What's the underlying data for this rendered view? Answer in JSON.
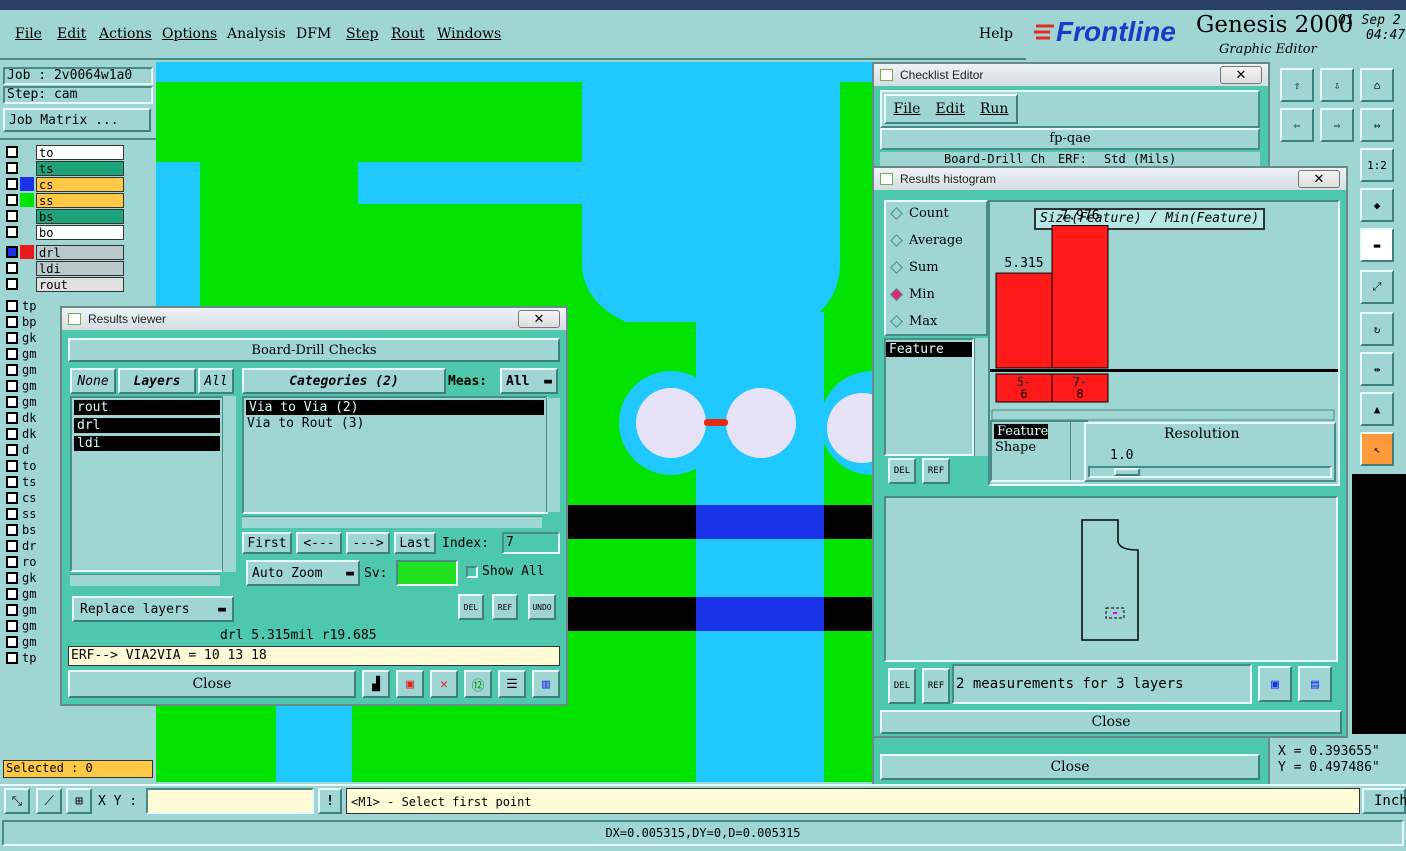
{
  "menu": {
    "file": "File",
    "edit": "Edit",
    "actions": "Actions",
    "options": "Options",
    "analysis": "Analysis",
    "dfm": "DFM",
    "step": "Step",
    "rout": "Rout",
    "windows": "Windows",
    "help": "Help"
  },
  "brand": {
    "logo": "Frontline",
    "product": "Genesis 2000",
    "subtitle": "Graphic Editor",
    "date": "01 Sep 2",
    "time": "04:47"
  },
  "left": {
    "job": "Job : 2v0064w1a0",
    "step": "Step: cam",
    "job_matrix": "Job Matrix ...",
    "layers_top": [
      {
        "name": "to",
        "color": "#ffffff"
      },
      {
        "name": "ts",
        "color": "#1fa37a"
      },
      {
        "name": "cs",
        "color": "#ffc845"
      },
      {
        "name": "ss",
        "color": "#ffc845"
      },
      {
        "name": "bs",
        "color": "#1fa37a"
      },
      {
        "name": "bo",
        "color": "#ffffff"
      }
    ],
    "layers_mid": [
      {
        "name": "drl",
        "color": "#b9c9cc"
      },
      {
        "name": "ldi",
        "color": "#b9c9cc"
      },
      {
        "name": "rout",
        "color": "#e0e0e0"
      }
    ],
    "layers_short": [
      "tp",
      "bp",
      "gk",
      "gm",
      "gm",
      "gm",
      "gm",
      "dk",
      "dk",
      "d",
      "to",
      "ts",
      "cs",
      "ss",
      "bs",
      "dr",
      "ro",
      "gk",
      "gm",
      "gm",
      "gm",
      "gm",
      "tp"
    ],
    "selected": "Selected : 0"
  },
  "results_viewer": {
    "title": "Results viewer",
    "header": "Board-Drill Checks",
    "none": "None",
    "layers": "Layers",
    "all": "All",
    "categories": "Categories (2)",
    "meas_label": "Meas:",
    "meas_value": "All",
    "layer_items": [
      "rout",
      "drl",
      "ldi"
    ],
    "category_items": [
      "Via to Via  (2)",
      "Via to Rout  (3)"
    ],
    "first": "First",
    "prev": "<---",
    "next": "--->",
    "last": "Last",
    "index_label": "Index:",
    "index_value": "7",
    "auto_zoom": "Auto Zoom",
    "sv_label": "Sv:",
    "show_all": "Show All",
    "replace_layers": "Replace layers",
    "del": "DEL",
    "ref": "REF",
    "undo": "UNDO",
    "info": "drl 5.315mil  r19.685",
    "erf": "ERF--> VIA2VIA = 10 13 18",
    "close": "Close"
  },
  "checklist": {
    "title": "Checklist Editor",
    "file": "File",
    "edit": "Edit",
    "run": "Run",
    "name": "fp-qae",
    "row_text": "Board-Drill Ch",
    "row_erf": "ERF:",
    "row_std": "Std (Mils)",
    "close": "Close"
  },
  "histogram": {
    "title": "Results histogram",
    "options": [
      {
        "label": "Count",
        "selected": false
      },
      {
        "label": "Average",
        "selected": false
      },
      {
        "label": "Sum",
        "selected": false
      },
      {
        "label": "Min",
        "selected": true
      },
      {
        "label": "Max",
        "selected": false
      }
    ],
    "attr_list": [
      "Feature"
    ],
    "chart_title": "Size(Feature) / Min(Feature)",
    "bars": [
      {
        "label": "5-6",
        "value": 5.315
      },
      {
        "label": "7-8",
        "value": 7.976
      }
    ],
    "bin_labels": [
      [
        "5-",
        "6"
      ],
      [
        "7-",
        "8"
      ]
    ],
    "bar_values": [
      "5.315",
      "7.976"
    ],
    "field_list": [
      "Feature",
      "Shape"
    ],
    "resolution_label": "Resolution",
    "resolution_value": "1.0",
    "summary": "2 measurements for 3 layers",
    "close": "Close"
  },
  "coords": {
    "x": "X = 0.393655\"",
    "y": "Y = 0.497486\""
  },
  "status": {
    "xy_label": "X Y :",
    "prompt": "<M1> - Select first point",
    "units": "Inch",
    "measure": "DX=0.005315,DY=0,D=0.005315"
  },
  "colors": {
    "panel": "#9fd6d4",
    "window": "#4ec8ad",
    "board": "#00e400",
    "cyan": "#1fc8ff",
    "hist_bar": "#ff1a1a"
  }
}
